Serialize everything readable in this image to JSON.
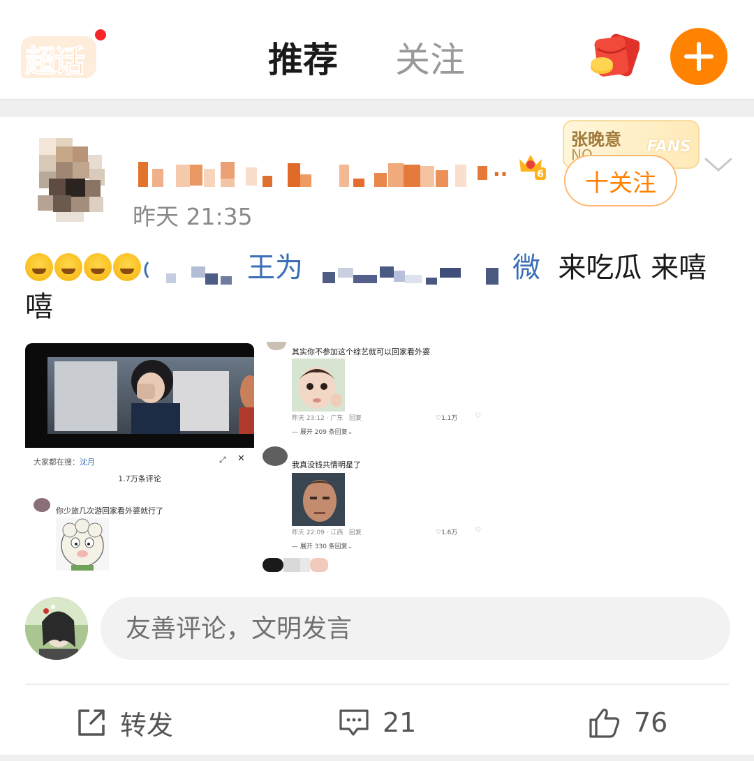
{
  "header": {
    "logo_text": "超话",
    "tabs": [
      {
        "label": "推荐",
        "active": true
      },
      {
        "label": "关注",
        "active": false
      }
    ],
    "accent_color": "#ff8200"
  },
  "post": {
    "username": "",
    "username_ellipsis": "..",
    "vip_level": "6",
    "time": "昨天 21:35",
    "fans_badge": {
      "name": "张晚意",
      "number": "NO.",
      "word": "FANS"
    },
    "follow_label": "十关注",
    "content": {
      "text_visible_1": "王为",
      "text_visible_2": "微",
      "text_visible_3": "来吃瓜 来嘻嘻"
    },
    "image_left": {
      "search_prefix": "大家都在搜：",
      "search_term": "沈月",
      "comment_count": "1.7万条评论",
      "comment_text": "你少旅几次游回家看外婆就行了"
    },
    "image_right": {
      "comments": [
        {
          "text": "其实你不参加这个综艺就可以回家看外婆",
          "meta": "昨天 23:12 · 广东",
          "reply": "回复",
          "likes": "1.1万",
          "expand": "展开 209 条回复"
        },
        {
          "text": "我真没钱共情明星了",
          "meta": "昨天 22:09 · 江西",
          "reply": "回复",
          "likes": "1.6万",
          "expand": "展开 330 条回复"
        }
      ]
    }
  },
  "comment_box": {
    "placeholder": "友善评论，文明发言"
  },
  "actions": {
    "repost_label": "转发",
    "comment_count": "21",
    "like_count": "76"
  }
}
